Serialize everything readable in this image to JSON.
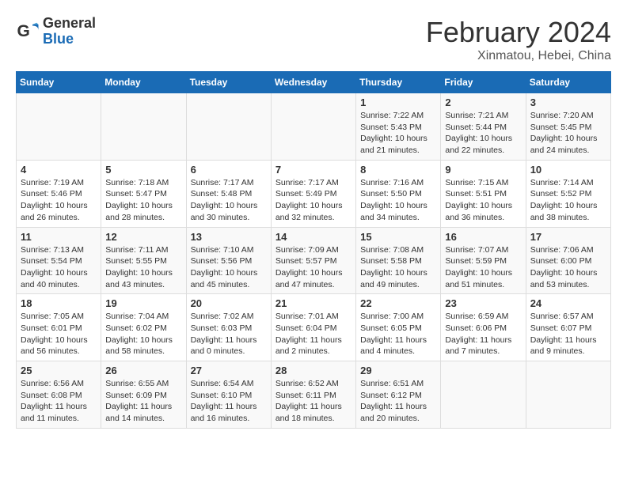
{
  "header": {
    "logo_general": "General",
    "logo_blue": "Blue",
    "month_title": "February 2024",
    "location": "Xinmatou, Hebei, China"
  },
  "days_of_week": [
    "Sunday",
    "Monday",
    "Tuesday",
    "Wednesday",
    "Thursday",
    "Friday",
    "Saturday"
  ],
  "weeks": [
    [
      {
        "day": "",
        "info": ""
      },
      {
        "day": "",
        "info": ""
      },
      {
        "day": "",
        "info": ""
      },
      {
        "day": "",
        "info": ""
      },
      {
        "day": "1",
        "info": "Sunrise: 7:22 AM\nSunset: 5:43 PM\nDaylight: 10 hours\nand 21 minutes."
      },
      {
        "day": "2",
        "info": "Sunrise: 7:21 AM\nSunset: 5:44 PM\nDaylight: 10 hours\nand 22 minutes."
      },
      {
        "day": "3",
        "info": "Sunrise: 7:20 AM\nSunset: 5:45 PM\nDaylight: 10 hours\nand 24 minutes."
      }
    ],
    [
      {
        "day": "4",
        "info": "Sunrise: 7:19 AM\nSunset: 5:46 PM\nDaylight: 10 hours\nand 26 minutes."
      },
      {
        "day": "5",
        "info": "Sunrise: 7:18 AM\nSunset: 5:47 PM\nDaylight: 10 hours\nand 28 minutes."
      },
      {
        "day": "6",
        "info": "Sunrise: 7:17 AM\nSunset: 5:48 PM\nDaylight: 10 hours\nand 30 minutes."
      },
      {
        "day": "7",
        "info": "Sunrise: 7:17 AM\nSunset: 5:49 PM\nDaylight: 10 hours\nand 32 minutes."
      },
      {
        "day": "8",
        "info": "Sunrise: 7:16 AM\nSunset: 5:50 PM\nDaylight: 10 hours\nand 34 minutes."
      },
      {
        "day": "9",
        "info": "Sunrise: 7:15 AM\nSunset: 5:51 PM\nDaylight: 10 hours\nand 36 minutes."
      },
      {
        "day": "10",
        "info": "Sunrise: 7:14 AM\nSunset: 5:52 PM\nDaylight: 10 hours\nand 38 minutes."
      }
    ],
    [
      {
        "day": "11",
        "info": "Sunrise: 7:13 AM\nSunset: 5:54 PM\nDaylight: 10 hours\nand 40 minutes."
      },
      {
        "day": "12",
        "info": "Sunrise: 7:11 AM\nSunset: 5:55 PM\nDaylight: 10 hours\nand 43 minutes."
      },
      {
        "day": "13",
        "info": "Sunrise: 7:10 AM\nSunset: 5:56 PM\nDaylight: 10 hours\nand 45 minutes."
      },
      {
        "day": "14",
        "info": "Sunrise: 7:09 AM\nSunset: 5:57 PM\nDaylight: 10 hours\nand 47 minutes."
      },
      {
        "day": "15",
        "info": "Sunrise: 7:08 AM\nSunset: 5:58 PM\nDaylight: 10 hours\nand 49 minutes."
      },
      {
        "day": "16",
        "info": "Sunrise: 7:07 AM\nSunset: 5:59 PM\nDaylight: 10 hours\nand 51 minutes."
      },
      {
        "day": "17",
        "info": "Sunrise: 7:06 AM\nSunset: 6:00 PM\nDaylight: 10 hours\nand 53 minutes."
      }
    ],
    [
      {
        "day": "18",
        "info": "Sunrise: 7:05 AM\nSunset: 6:01 PM\nDaylight: 10 hours\nand 56 minutes."
      },
      {
        "day": "19",
        "info": "Sunrise: 7:04 AM\nSunset: 6:02 PM\nDaylight: 10 hours\nand 58 minutes."
      },
      {
        "day": "20",
        "info": "Sunrise: 7:02 AM\nSunset: 6:03 PM\nDaylight: 11 hours\nand 0 minutes."
      },
      {
        "day": "21",
        "info": "Sunrise: 7:01 AM\nSunset: 6:04 PM\nDaylight: 11 hours\nand 2 minutes."
      },
      {
        "day": "22",
        "info": "Sunrise: 7:00 AM\nSunset: 6:05 PM\nDaylight: 11 hours\nand 4 minutes."
      },
      {
        "day": "23",
        "info": "Sunrise: 6:59 AM\nSunset: 6:06 PM\nDaylight: 11 hours\nand 7 minutes."
      },
      {
        "day": "24",
        "info": "Sunrise: 6:57 AM\nSunset: 6:07 PM\nDaylight: 11 hours\nand 9 minutes."
      }
    ],
    [
      {
        "day": "25",
        "info": "Sunrise: 6:56 AM\nSunset: 6:08 PM\nDaylight: 11 hours\nand 11 minutes."
      },
      {
        "day": "26",
        "info": "Sunrise: 6:55 AM\nSunset: 6:09 PM\nDaylight: 11 hours\nand 14 minutes."
      },
      {
        "day": "27",
        "info": "Sunrise: 6:54 AM\nSunset: 6:10 PM\nDaylight: 11 hours\nand 16 minutes."
      },
      {
        "day": "28",
        "info": "Sunrise: 6:52 AM\nSunset: 6:11 PM\nDaylight: 11 hours\nand 18 minutes."
      },
      {
        "day": "29",
        "info": "Sunrise: 6:51 AM\nSunset: 6:12 PM\nDaylight: 11 hours\nand 20 minutes."
      },
      {
        "day": "",
        "info": ""
      },
      {
        "day": "",
        "info": ""
      }
    ]
  ]
}
